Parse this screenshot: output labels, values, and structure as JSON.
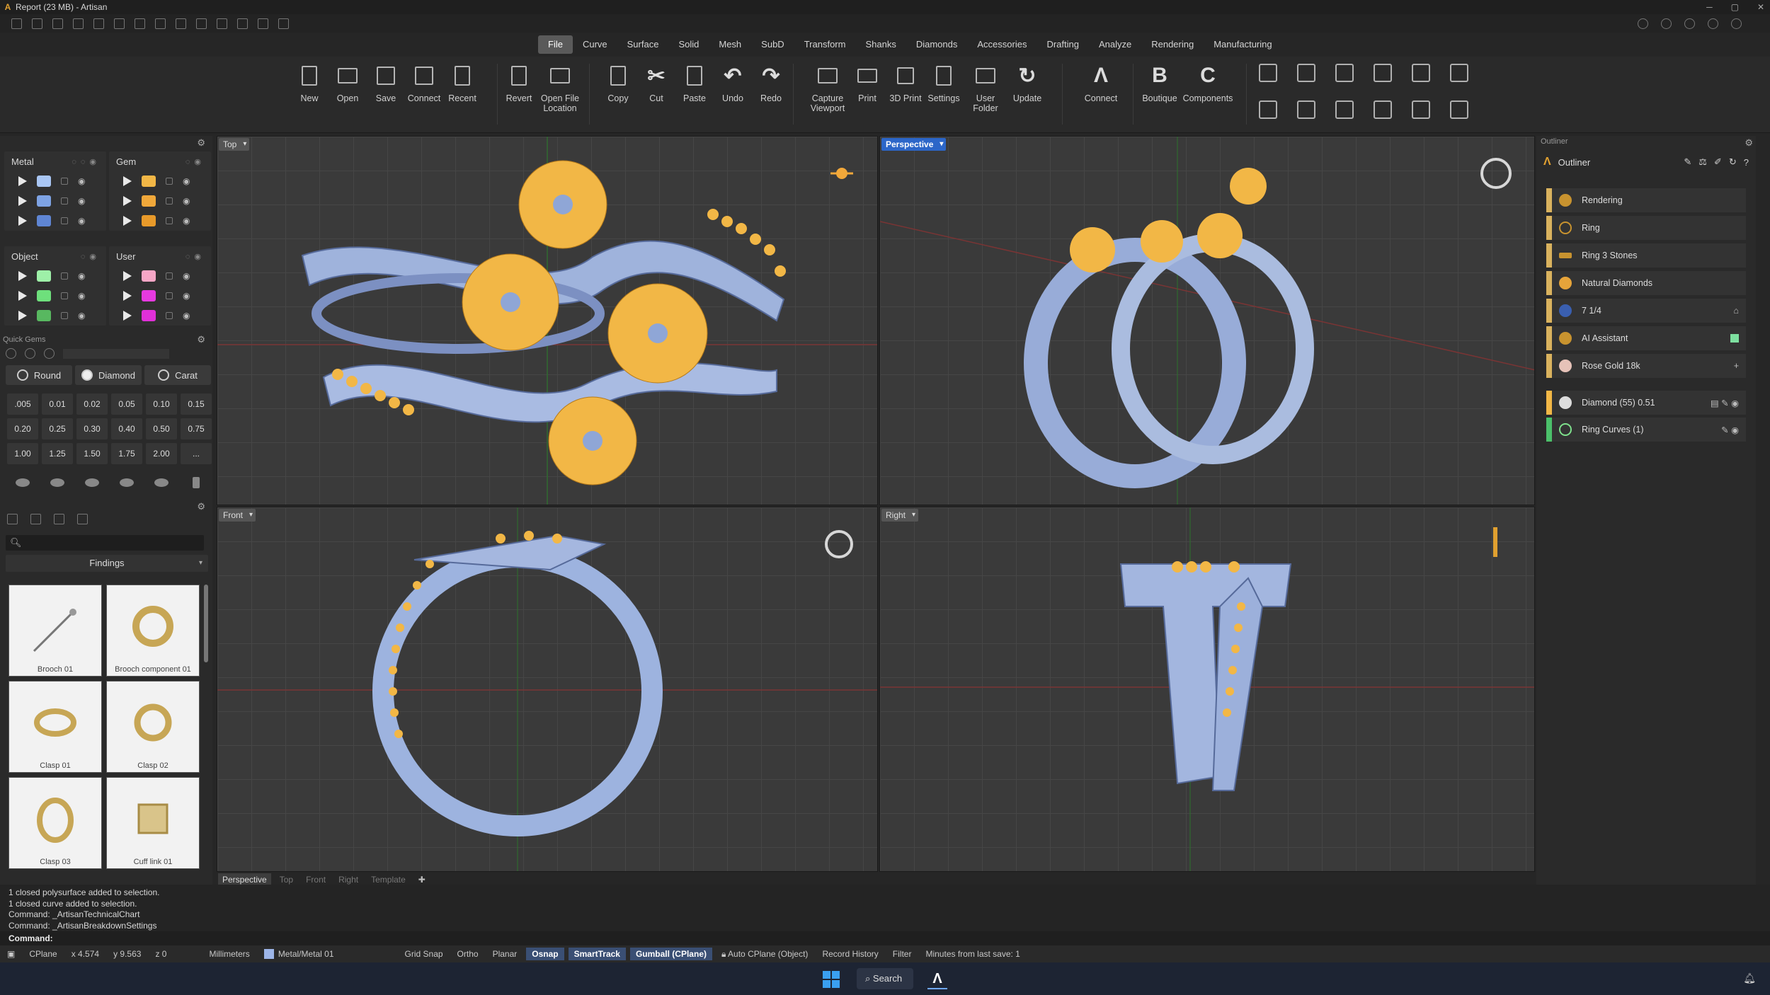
{
  "window": {
    "title": "Report (23 MB) - Artisan",
    "controls": [
      "─",
      "▢",
      "✕"
    ]
  },
  "menu": [
    "File",
    "Curve",
    "Surface",
    "Solid",
    "Mesh",
    "SubD",
    "Transform",
    "Shanks",
    "Diamonds",
    "Accessories",
    "Drafting",
    "Analyze",
    "Rendering",
    "Manufacturing"
  ],
  "ribbon": {
    "buttons": [
      "New",
      "Open",
      "Save",
      "Connect",
      "Recent",
      "Revert",
      "Open File Location",
      "Copy",
      "Cut",
      "Paste",
      "Undo",
      "Redo",
      "Capture Viewport",
      "Print",
      "3D Print",
      "Settings",
      "User Folder",
      "Update",
      "Connect",
      "Boutique",
      "Components"
    ]
  },
  "layers": {
    "metal": {
      "title": "Metal",
      "colors": [
        "#a9c6f4",
        "#7ea3e4",
        "#5f86d4"
      ]
    },
    "gem": {
      "title": "Gem",
      "colors": [
        "#f2b746",
        "#f0a83a",
        "#e89a2a"
      ]
    },
    "object": {
      "title": "Object",
      "colors": [
        "#9ef0a8",
        "#6ee07c",
        "#58b860"
      ]
    },
    "user": {
      "title": "User",
      "colors": [
        "#f6a6c6",
        "#e63ae0",
        "#e030d8"
      ]
    }
  },
  "quick_gems": {
    "label": "Quick Gems",
    "tabs": [
      "Round",
      "Diamond",
      "Carat"
    ],
    "sizes": [
      ".005",
      "0.01",
      "0.02",
      "0.05",
      "0.10",
      "0.15",
      "0.20",
      "0.25",
      "0.30",
      "0.40",
      "0.50",
      "0.75",
      "1.00",
      "1.25",
      "1.50",
      "1.75",
      "2.00",
      "..."
    ]
  },
  "library": {
    "category": "Findings",
    "items": [
      "Brooch 01",
      "Brooch component 01",
      "Clasp 01",
      "Clasp 02",
      "Clasp 03",
      "Cuff link 01"
    ]
  },
  "viewports": {
    "top": "Top",
    "perspective": "Perspective",
    "front": "Front",
    "right": "Right"
  },
  "viewport_tabs": [
    "Perspective",
    "Top",
    "Front",
    "Right",
    "Template"
  ],
  "outliner": {
    "panel_label": "Outliner",
    "title": "Outliner",
    "items": [
      "Rendering",
      "Ring",
      "Ring 3 Stones",
      "Natural Diamonds",
      "7 1/4",
      "AI Assistant",
      "Rose Gold 18k"
    ],
    "layers": [
      "Diamond (55) 0.51",
      "Ring Curves (1)"
    ]
  },
  "command_history": [
    "1 closed polysurface added to selection.",
    "1 closed curve added to selection.",
    "Command: _ArtisanTechnicalChart",
    "Command: _ArtisanBreakdownSettings"
  ],
  "command_prompt": "Command:",
  "status": {
    "cplane": "CPlane",
    "x": "x 4.574",
    "y": "y 9.563",
    "z": "z 0",
    "units": "Millimeters",
    "material": "Metal/Metal 01",
    "grid_snap": "Grid Snap",
    "ortho": "Ortho",
    "planar": "Planar",
    "osnap": "Osnap",
    "smarttrack": "SmartTrack",
    "gumball": "Gumball (CPlane)",
    "auto_cplane": "Auto CPlane (Object)",
    "record_history": "Record History",
    "filter": "Filter",
    "minutes": "Minutes from last save: 1"
  },
  "taskbar": {
    "search": "Search"
  },
  "colors": {
    "metal": "#9db5e8",
    "gem": "#f2b746",
    "accent": "#2c66c8"
  }
}
